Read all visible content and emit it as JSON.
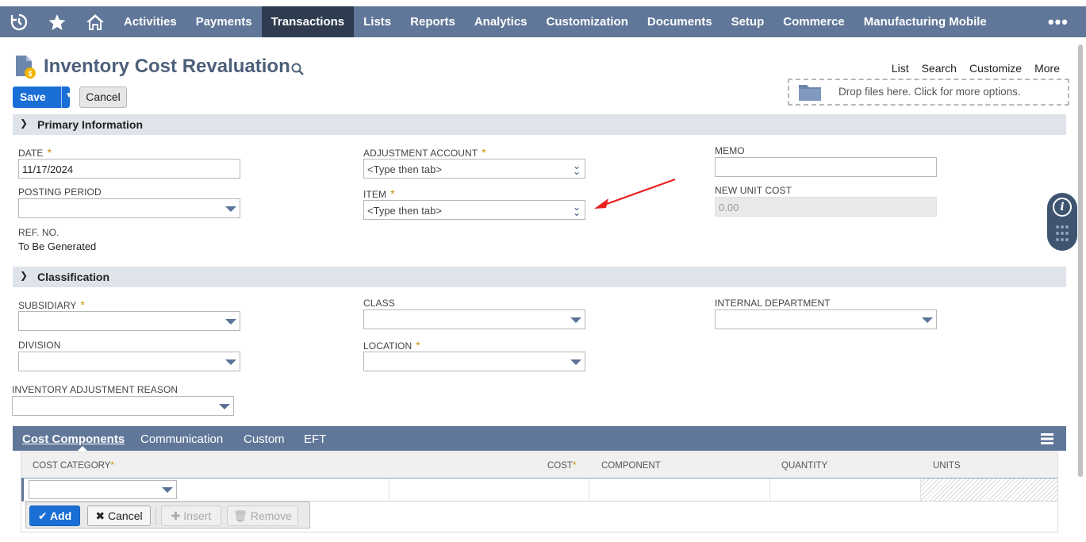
{
  "nav": {
    "icons": [
      "recent-records-icon",
      "star-icon",
      "home-icon"
    ],
    "items": [
      {
        "label": "Activities",
        "active": false
      },
      {
        "label": "Payments",
        "active": false
      },
      {
        "label": "Transactions",
        "active": true
      },
      {
        "label": "Lists",
        "active": false
      },
      {
        "label": "Reports",
        "active": false
      },
      {
        "label": "Analytics",
        "active": false
      },
      {
        "label": "Customization",
        "active": false
      },
      {
        "label": "Documents",
        "active": false
      },
      {
        "label": "Setup",
        "active": false
      },
      {
        "label": "Commerce",
        "active": false
      },
      {
        "label": "Manufacturing Mobile",
        "active": false
      }
    ],
    "more": "•••"
  },
  "header": {
    "title": "Inventory Cost Revaluation",
    "links": [
      "List",
      "Search",
      "Customize",
      "More"
    ],
    "dropzone": "Drop files here. Click for more options."
  },
  "buttons": {
    "save": "Save",
    "cancel": "Cancel"
  },
  "primary": {
    "section_title": "Primary Information",
    "date_label": "DATE",
    "date_value": "11/17/2024",
    "posting_period_label": "POSTING PERIOD",
    "ref_no_label": "REF. NO.",
    "ref_no_value": "To Be Generated",
    "adjustment_account_label": "ADJUSTMENT ACCOUNT",
    "adjustment_account_placeholder": "<Type then tab>",
    "item_label": "ITEM",
    "item_placeholder": "<Type then tab>",
    "memo_label": "MEMO",
    "new_unit_cost_label": "NEW UNIT COST",
    "new_unit_cost_value": "0.00"
  },
  "classification": {
    "section_title": "Classification",
    "subsidiary_label": "SUBSIDIARY",
    "division_label": "DIVISION",
    "class_label": "CLASS",
    "location_label": "LOCATION",
    "internal_department_label": "INTERNAL DEPARTMENT",
    "inventory_adjustment_reason_label": "INVENTORY ADJUSTMENT REASON"
  },
  "required_mark": "*",
  "subtabs": {
    "tabs": [
      "Cost Components",
      "Communication",
      "Custom",
      "EFT"
    ],
    "active": "Cost Components"
  },
  "cost_grid": {
    "columns": [
      "COST CATEGORY",
      "COST",
      "COMPONENT",
      "QUANTITY",
      "UNITS"
    ],
    "actions": {
      "add": "Add",
      "cancel": "Cancel",
      "insert": "Insert",
      "remove": "Remove"
    }
  },
  "colors": {
    "nav_bg": "#607799",
    "nav_active": "#2f3c4f",
    "primary_button": "#1a6fd6",
    "required": "#c69200",
    "annotation_arrow": "#e8201e"
  }
}
